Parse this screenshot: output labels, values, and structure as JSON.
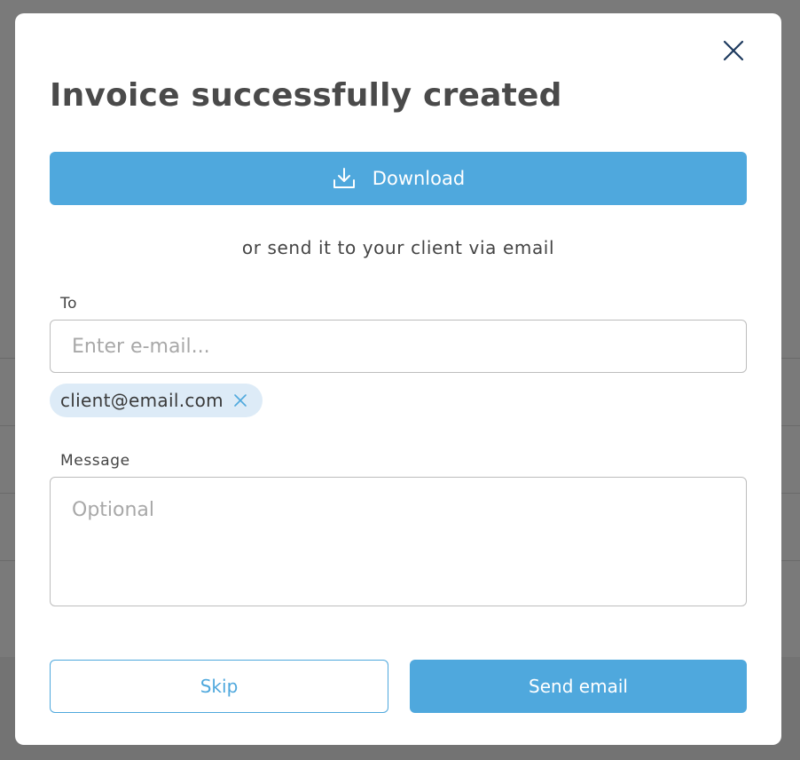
{
  "modal": {
    "title": "Invoice successfully created",
    "download_label": "Download",
    "subtitle": "or send it to your client via email",
    "to_label": "To",
    "to_placeholder": "Enter e-mail...",
    "recipients": [
      "client@email.com"
    ],
    "message_label": "Message",
    "message_placeholder": "Optional",
    "skip_label": "Skip",
    "send_label": "Send email"
  },
  "colors": {
    "accent": "#4fa8dd",
    "chip_background": "#ddebf7",
    "title_text": "#4a4a4a",
    "overlay": "#7a7a7a"
  },
  "icons": {
    "close": "close-icon",
    "download": "download-icon",
    "chip_remove": "remove-recipient-icon"
  }
}
